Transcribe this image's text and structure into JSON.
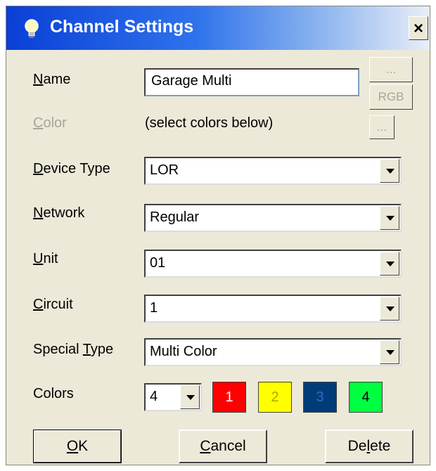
{
  "window": {
    "title": "Channel Settings",
    "close_label": "×"
  },
  "fields": {
    "name": {
      "label_accel": "N",
      "label_rest": "ame",
      "value": "Garage Multi"
    },
    "color": {
      "label_accel": "C",
      "label_rest": "olor",
      "hint": "(select colors below)"
    },
    "device_type": {
      "label_accel": "D",
      "label_rest": "evice Type",
      "value": "LOR"
    },
    "network": {
      "label_accel": "N",
      "label_rest": "etwork",
      "value": "Regular"
    },
    "unit": {
      "label_accel": "U",
      "label_rest": "nit",
      "value": "01"
    },
    "circuit": {
      "label_accel": "C",
      "label_rest": "ircuit",
      "value": "1"
    },
    "special_type": {
      "label_pre": "Special ",
      "label_accel": "T",
      "label_rest": "ype",
      "value": "Multi Color"
    },
    "colors": {
      "label": "Colors",
      "count": "4"
    }
  },
  "side_buttons": {
    "name_browse": "...",
    "rgb": "RGB",
    "color_browse": "..."
  },
  "swatches": [
    {
      "label": "1",
      "color": "#ff0000",
      "text_color": "#ffffff"
    },
    {
      "label": "2",
      "color": "#ffff00",
      "text_color": "#a8a800"
    },
    {
      "label": "3",
      "color": "#003c78",
      "text_color": "#2a70c0"
    },
    {
      "label": "4",
      "color": "#00ff40",
      "text_color": "#000000"
    }
  ],
  "buttons": {
    "ok": {
      "accel": "O",
      "rest": "K"
    },
    "cancel": {
      "accel": "C",
      "rest": "ancel"
    },
    "delete": {
      "pre": "De",
      "accel": "l",
      "rest": "ete"
    }
  }
}
